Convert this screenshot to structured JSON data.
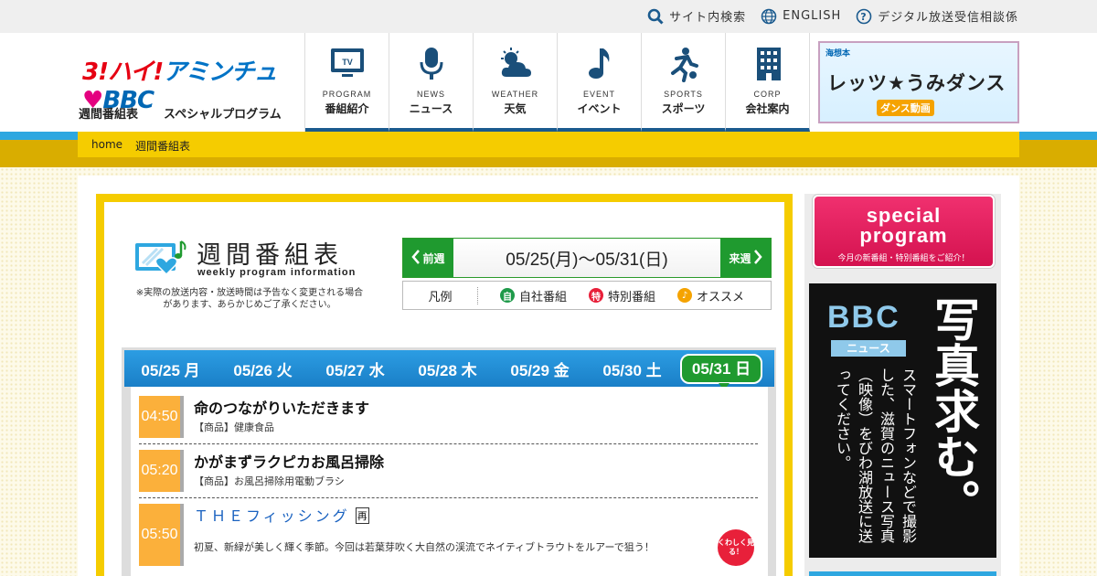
{
  "top_links": [
    {
      "label": "サイト内検索",
      "icon": "search-icon"
    },
    {
      "label": "ENGLISH",
      "icon": "globe-icon"
    },
    {
      "label": "デジタル放送受信相談係",
      "icon": "question-icon"
    }
  ],
  "logo": {
    "part1": "3!ハイ!",
    "part2": "アミンチュ",
    "part3": "BBC"
  },
  "subnav": [
    "週間番組表",
    "スペシャルプログラム"
  ],
  "gnav": [
    {
      "en": "PROGRAM",
      "ja": "番組紹介",
      "icon": "tv-icon"
    },
    {
      "en": "NEWS",
      "ja": "ニュース",
      "icon": "microphone-icon"
    },
    {
      "en": "WEATHER",
      "ja": "天気",
      "icon": "weather-icon"
    },
    {
      "en": "EVENT",
      "ja": "イベント",
      "icon": "music-note-icon"
    },
    {
      "en": "SPORTS",
      "ja": "スポーツ",
      "icon": "sports-icon"
    },
    {
      "en": "CORP",
      "ja": "会社案内",
      "icon": "building-icon"
    }
  ],
  "dance_banner": {
    "top": "海想本",
    "title": "レッツ★うみダンス",
    "sub": "ダンス動画"
  },
  "breadcrumb": [
    "home",
    "週間番組表"
  ],
  "page_title": {
    "ja": "週間番組表",
    "en": "weekly program information"
  },
  "note": "※実際の放送内容・放送時間は予告なく変更される場合があります、あらかじめご了承ください。",
  "week_nav": {
    "prev": "前週",
    "range": "05/25(月)～05/31(日)",
    "next": "来週"
  },
  "legend": {
    "title": "凡例",
    "items": [
      {
        "mark": "自",
        "label": "自社番組",
        "color": "#1f9a4a"
      },
      {
        "mark": "特",
        "label": "特別番組",
        "color": "#e8203a"
      },
      {
        "mark": "♪",
        "label": "オススメ",
        "color": "#f5a300"
      }
    ]
  },
  "days": [
    "05/25 月",
    "05/26 火",
    "05/27 水",
    "05/28 木",
    "05/29 金",
    "05/30 土",
    "05/31 日"
  ],
  "active_day": "05/31 日",
  "programs": [
    {
      "time": "04:50",
      "title": "命のつながりいただきます",
      "desc": "【商品】健康食品"
    },
    {
      "time": "05:20",
      "title": "かがまずラクピカお風呂掃除",
      "desc": "【商品】お風呂掃除用電動ブラシ"
    },
    {
      "time": "05:50",
      "title": "ＴＨＥフィッシング",
      "badge": "再",
      "desc": "初夏、新緑が美しく輝く季節。今回は若葉芽吹く大自然の渓流でネイティブトラウトをルアーで狙う！"
    }
  ],
  "more_button": "くわしく見る！",
  "special_banner": {
    "title1": "special",
    "title2": "program",
    "sub": "今月の新番組・特別番組をご紹介！"
  },
  "news_banner": {
    "logo": "BBC",
    "sub": "ニュース",
    "big": "写真求む。",
    "text": "スマートフォンなどで撮影した、滋賀のニュース写真（映像）をびわ湖放送に送ってください。"
  }
}
